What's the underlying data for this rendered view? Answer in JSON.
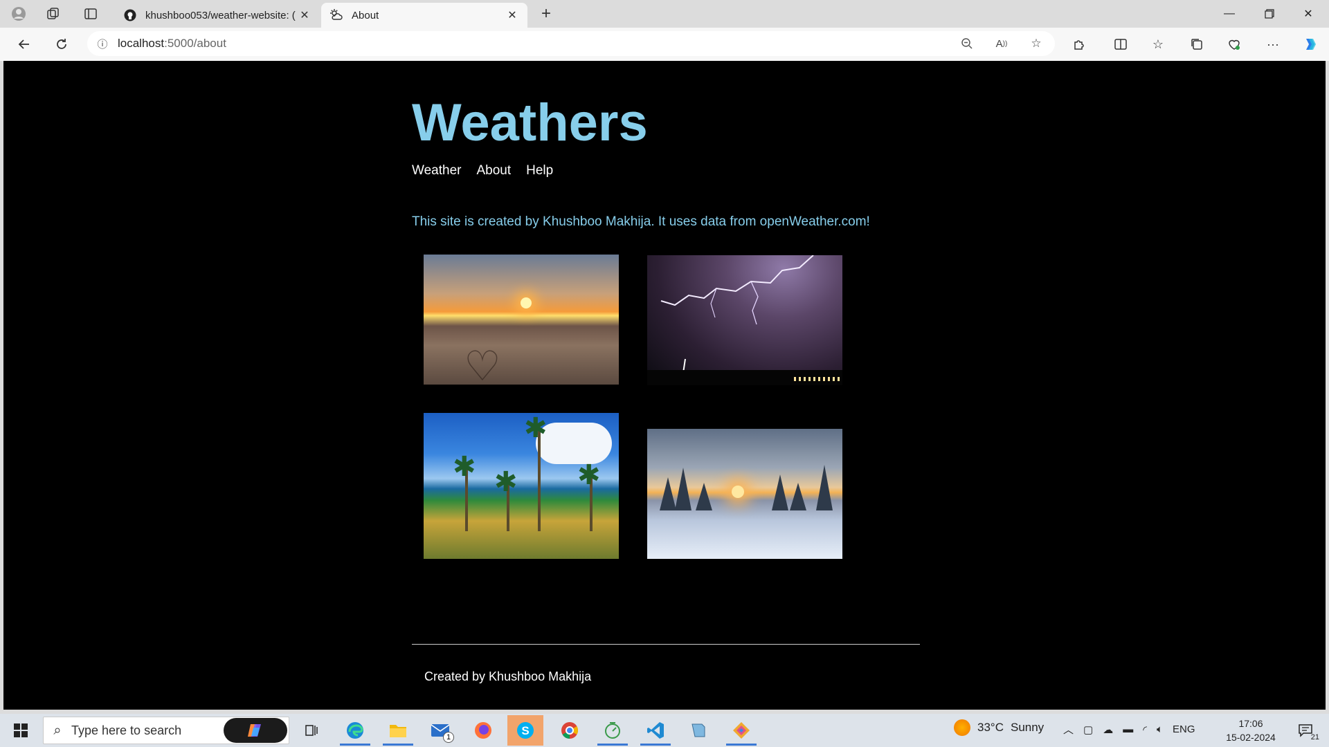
{
  "browser": {
    "tabs": [
      {
        "title": "khushboo053/weather-website: (",
        "favicon": "github-icon",
        "active": false
      },
      {
        "title": "About",
        "favicon": "weather-icon",
        "active": true
      }
    ],
    "address": {
      "host": "localhost",
      "path": ":5000/about"
    }
  },
  "site": {
    "title": "Weathers",
    "nav": [
      "Weather",
      "About",
      "Help"
    ],
    "about_text": "This site is created by Khushboo Makhija. It uses data from openWeather.com!",
    "images": [
      "sunset-beach-photo",
      "lightning-storm-photo",
      "tropical-palms-photo",
      "snow-sunset-photo"
    ],
    "footer": "Created by Khushboo Makhija"
  },
  "taskbar": {
    "search_placeholder": "Type here to search",
    "weather": {
      "temp": "33°C",
      "condition": "Sunny"
    },
    "language": "ENG",
    "time": "17:06",
    "date": "15-02-2024",
    "mail_badge": "1",
    "notification_count": "21"
  },
  "colors": {
    "accent": "#87ceeb",
    "page_bg": "#000000",
    "taskbar_accent": "#3a78d4"
  }
}
